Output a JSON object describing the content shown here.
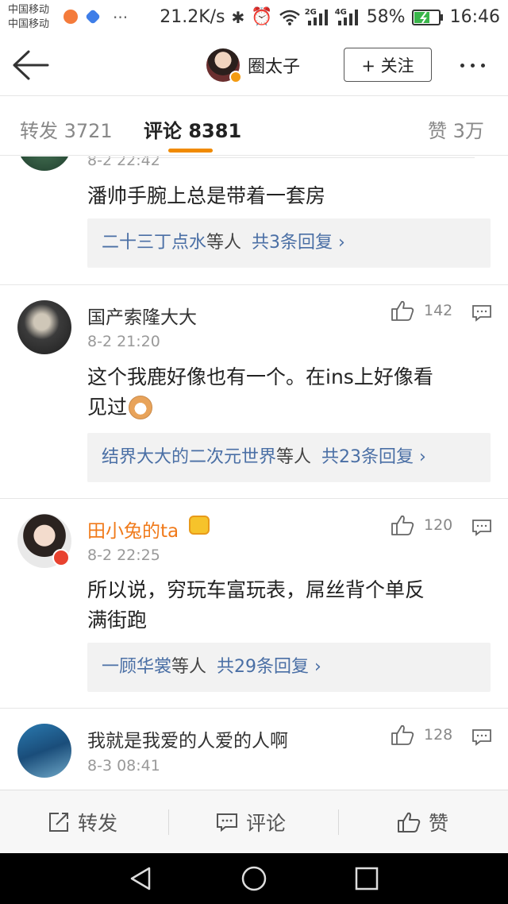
{
  "status_bar": {
    "carrier_1": "中国移动",
    "carrier_2": "中国移动",
    "net_speed": "21.2K/s",
    "net_2g": "2G",
    "net_4g": "4G",
    "battery": "58%",
    "time": "16:46"
  },
  "header": {
    "name": "圈太子",
    "follow_label": "+ 关注"
  },
  "tabs": {
    "repost": "转发 3721",
    "comments": "评论 8381",
    "likes": "赞 3万"
  },
  "comments": [
    {
      "time": "8-2 22:42",
      "text": "潘帅手腕上总是带着一套房",
      "reply_users": "二十三丁点水",
      "reply_mid": "等人",
      "reply_total": "共3条回复 ›"
    },
    {
      "user": "国产索隆大大",
      "time": "8-2 21:20",
      "likes": "142",
      "text_line1": "这个我鹿好像也有一个。在ins上好像看",
      "text_line2": "见过",
      "reply_users": "结界大大的二次元世界",
      "reply_mid": "等人",
      "reply_total": "共23条回复 ›"
    },
    {
      "user": "田小兔的ta",
      "time": "8-2 22:25",
      "likes": "120",
      "text_line1": "所以说，穷玩车富玩表，屌丝背个单反",
      "text_line2": "满街跑",
      "reply_users": "一顾华裳",
      "reply_mid": "等人",
      "reply_total": "共29条回复 ›"
    },
    {
      "user": "我就是我爱的人爱的人啊",
      "time": "8-3 08:41",
      "likes": "128"
    }
  ],
  "bottom_bar": {
    "repost": "转发",
    "comment": "评论",
    "like": "赞"
  },
  "colors": {
    "accent": "#f08a00",
    "link": "#4a6fa5",
    "vip_name": "#f07a1a"
  }
}
